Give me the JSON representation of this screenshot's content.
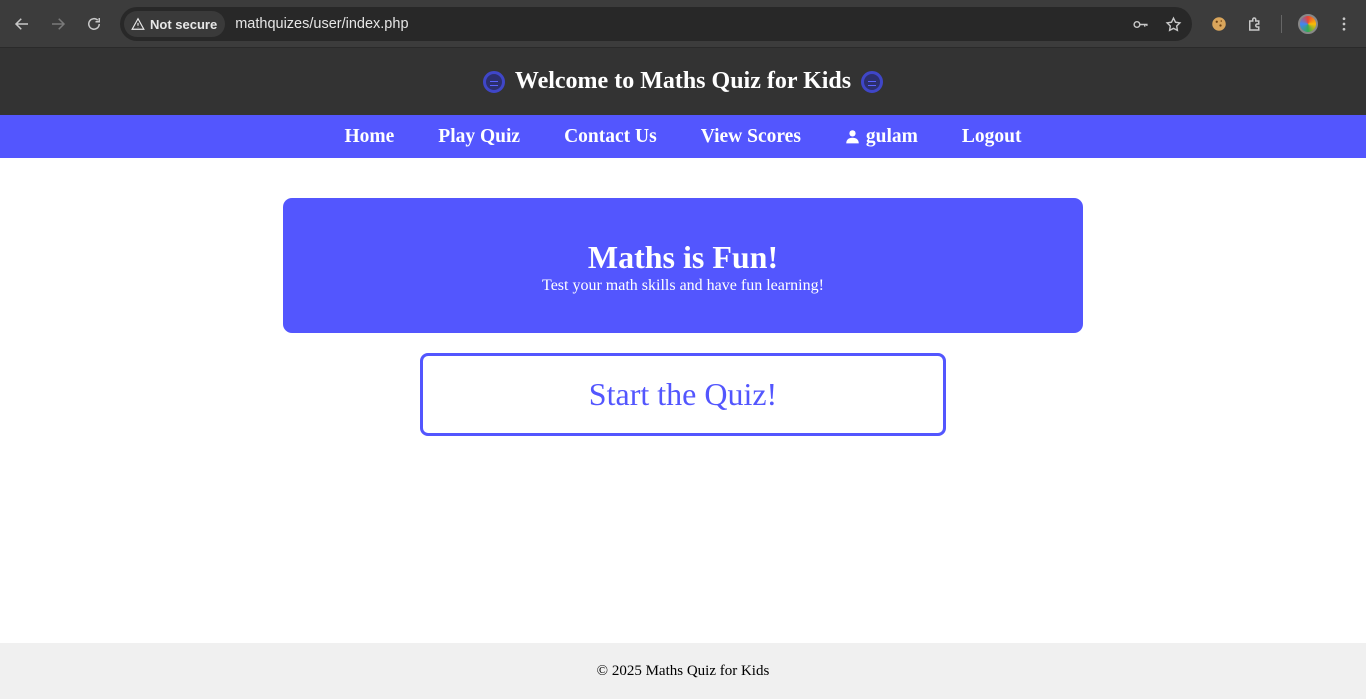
{
  "browser": {
    "back_icon": "arrow-left-icon",
    "forward_icon": "arrow-right-icon",
    "reload_icon": "reload-icon",
    "security_label": "Not secure",
    "url": "mathquizes/user/index.php"
  },
  "header": {
    "title": "Welcome to Maths Quiz for Kids"
  },
  "nav": {
    "items": [
      {
        "label": "Home"
      },
      {
        "label": "Play Quiz"
      },
      {
        "label": "Contact Us"
      },
      {
        "label": "View Scores"
      },
      {
        "label": "gulam"
      },
      {
        "label": "Logout"
      }
    ]
  },
  "hero": {
    "title": "Maths is Fun!",
    "subtitle": "Test your math skills and have fun learning!"
  },
  "main": {
    "start_label": "Start the Quiz!"
  },
  "footer": {
    "text": "© 2025 Maths Quiz for Kids"
  },
  "colors": {
    "accent": "#5356fe",
    "header_bg": "#333333",
    "footer_bg": "#f0f0f0"
  }
}
